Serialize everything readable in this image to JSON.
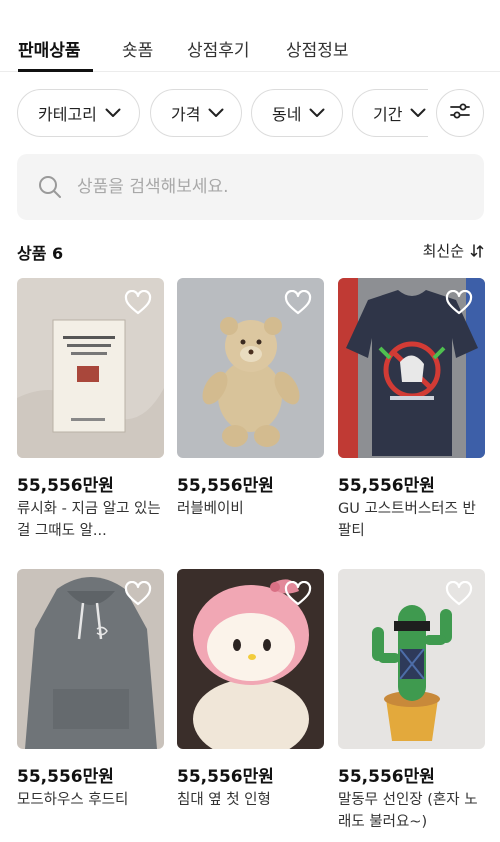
{
  "tabs": [
    {
      "label": "판매상품",
      "active": true
    },
    {
      "label": "숏폼",
      "active": false
    },
    {
      "label": "상점후기",
      "active": false
    },
    {
      "label": "상점정보",
      "active": false
    }
  ],
  "filters": {
    "chips": [
      {
        "label": "카테고리",
        "icon": "chevron-down-icon"
      },
      {
        "label": "가격",
        "icon": "chevron-down-icon"
      },
      {
        "label": "동네",
        "icon": "chevron-down-icon"
      },
      {
        "label": "기간",
        "icon": "chevron-down-icon"
      }
    ],
    "settings_icon": "sliders-icon"
  },
  "search": {
    "placeholder": "상품을 검색해보세요.",
    "icon": "search-icon"
  },
  "summary": {
    "count_label": "상품 6",
    "sort_label": "최신순",
    "sort_icon": "sort-icon"
  },
  "products": [
    {
      "price": "55,556만원",
      "title": "류시화 - 지금 알고 있는 걸 그때도 알...",
      "image": "book-photo"
    },
    {
      "price": "55,556만원",
      "title": "러블베이비",
      "image": "teddy-bear-photo"
    },
    {
      "price": "55,556만원",
      "title": "GU 고스트버스터즈 반팔티",
      "image": "tshirt-photo"
    },
    {
      "price": "55,556만원",
      "title": "모드하우스 후드티",
      "image": "hoodie-photo"
    },
    {
      "price": "55,556만원",
      "title": "침대 옆 첫 인형",
      "image": "plush-doll-photo"
    },
    {
      "price": "55,556만원",
      "title": "말동무 선인장 (혼자 노래도 불러요~)",
      "image": "dancing-cactus-photo"
    }
  ]
}
